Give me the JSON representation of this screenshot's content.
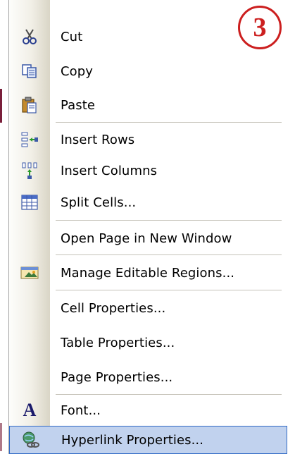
{
  "badge": {
    "number": "3"
  },
  "menu": {
    "items": [
      {
        "label": "Cut",
        "icon": "scissors-icon"
      },
      {
        "label": "Copy",
        "icon": "copy-icon"
      },
      {
        "label": "Paste",
        "icon": "paste-icon"
      },
      {
        "label": "Insert Rows",
        "icon": "insert-rows-icon"
      },
      {
        "label": "Insert Columns",
        "icon": "insert-columns-icon"
      },
      {
        "label": "Split Cells...",
        "icon": "split-cells-icon"
      },
      {
        "label": "Open Page in New Window",
        "icon": ""
      },
      {
        "label": "Manage Editable Regions...",
        "icon": "editable-regions-icon"
      },
      {
        "label": "Cell Properties...",
        "icon": ""
      },
      {
        "label": "Table Properties...",
        "icon": ""
      },
      {
        "label": "Page Properties...",
        "icon": ""
      },
      {
        "label": "Font...",
        "icon": "font-icon",
        "glyph": "A"
      },
      {
        "label": "Hyperlink Properties...",
        "icon": "hyperlink-icon",
        "highlighted": true
      }
    ]
  },
  "colors": {
    "highlight": "#c1d2ee",
    "highlight_border": "#316ac5",
    "badge": "#cc1f1f"
  }
}
